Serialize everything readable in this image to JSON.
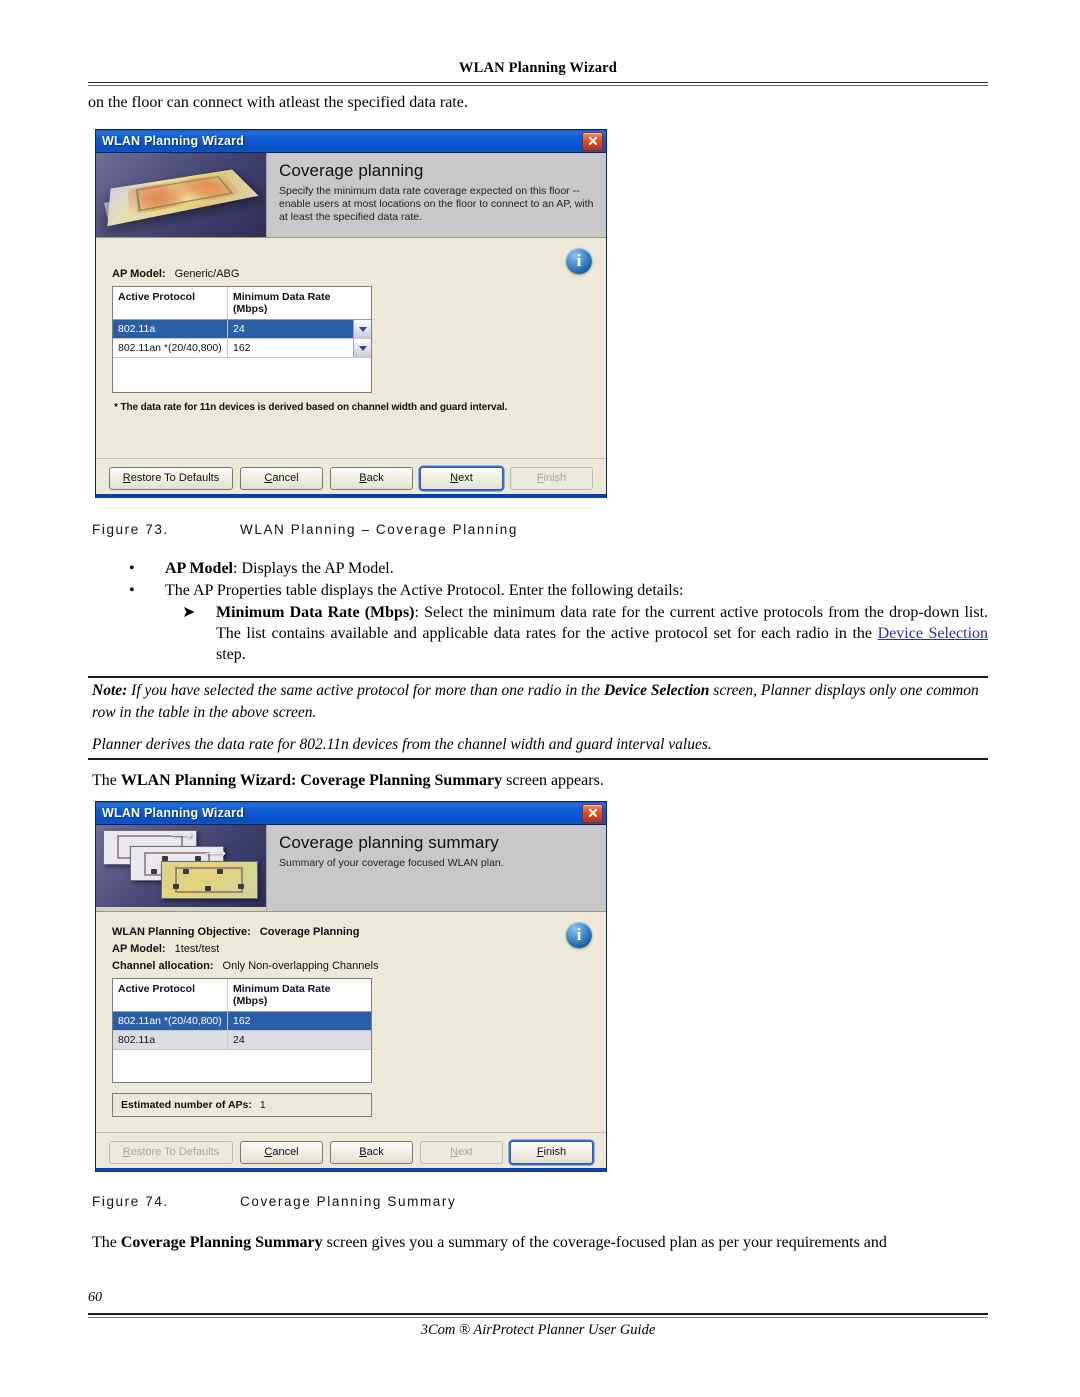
{
  "header": {
    "running_head": "WLAN Planning Wizard"
  },
  "intro_text": "on the floor can connect with atleast the specified data rate.",
  "dialog1": {
    "title": "WLAN Planning Wizard",
    "close_icon": "close-icon",
    "banner": {
      "heading": "Coverage planning",
      "description": "Specify the minimum data rate coverage expected on this floor -- enable users at most locations on the floor to connect to an AP, with at least the specified data rate.",
      "art": "floorplan-heatmap-3d"
    },
    "info_icon": "info-icon",
    "ap_model_label": "AP Model:",
    "ap_model_value": "Generic/ABG",
    "table": {
      "columns": [
        "Active Protocol",
        "Minimum Data Rate (Mbps)"
      ],
      "col1_header": "Active Protocol",
      "col2_header_line1": "Minimum Data Rate",
      "col2_header_line2": "(Mbps)",
      "rows": [
        {
          "protocol": "802.11a",
          "rate": "24",
          "selected": true,
          "dropdown": true
        },
        {
          "protocol": "802.11an *(20/40,800)",
          "rate": "162",
          "selected": false,
          "dropdown": true
        }
      ]
    },
    "footnote": "* The data rate for 11n devices is derived based on channel width and guard interval.",
    "buttons": [
      {
        "label": "Restore To Defaults",
        "accel": "R",
        "state": "enabled",
        "wide": true
      },
      {
        "label": "Cancel",
        "accel": "C",
        "state": "enabled",
        "wide": false
      },
      {
        "label": "Back",
        "accel": "B",
        "state": "enabled",
        "wide": false
      },
      {
        "label": "Next",
        "accel": "N",
        "state": "default",
        "wide": false
      },
      {
        "label": "Finish",
        "accel": "F",
        "state": "disabled",
        "wide": false
      }
    ]
  },
  "figure73": {
    "number": "Figure 73.",
    "caption": "WLAN Planning – Coverage Planning"
  },
  "bullets": {
    "b1_bold": "AP Model",
    "b1_rest": ": Displays the AP Model.",
    "b2": "The AP Properties table displays the Active Protocol. Enter the following details:",
    "sub_bold": "Minimum Data Rate (Mbps)",
    "sub_rest1": ": Select the minimum data rate for the current active protocols from the drop-down",
    "sub_rest2": "list. The list contains available and applicable data rates for the active protocol set for each radio in the ",
    "sub_link": "Device Selection",
    "sub_rest3": " step."
  },
  "note": {
    "label": "Note:",
    "line1_a": " If you have selected the same active protocol for more than one radio in the ",
    "line1_bold": "Device Selection",
    "line1_b": " screen, Planner displays only one",
    "line2": "common row in the table in the above screen.",
    "line3": "Planner derives the data rate for 802.11n devices from the channel width and guard interval values."
  },
  "lead_in": {
    "pre": "The ",
    "bold": "WLAN Planning Wizard: Coverage Planning Summary",
    "post": " screen appears."
  },
  "dialog2": {
    "title": "WLAN Planning Wizard",
    "close_icon": "close-icon",
    "banner": {
      "heading": "Coverage planning summary",
      "description": "Summary of your coverage focused WLAN plan.",
      "art": "stacked-floorplans"
    },
    "info_icon": "info-icon",
    "objective_label": "WLAN Planning Objective:",
    "objective_value": "Coverage Planning",
    "ap_model_label": "AP Model:",
    "ap_model_value": "1test/test",
    "channel_label": "Channel allocation:",
    "channel_value": "Only Non-overlapping Channels",
    "table": {
      "col1_header": "Active Protocol",
      "col2_header_line1": "Minimum Data Rate",
      "col2_header_line2": "(Mbps)",
      "rows": [
        {
          "protocol": "802.11an *(20/40,800)",
          "rate": "162",
          "selected": true,
          "dropdown": false
        },
        {
          "protocol": "802.11a",
          "rate": "24",
          "selected": false,
          "dropdown": false
        }
      ]
    },
    "estimated_label": "Estimated number of APs:",
    "estimated_value": "1",
    "buttons": [
      {
        "label": "Restore To Defaults",
        "accel": "R",
        "state": "disabled",
        "wide": true
      },
      {
        "label": "Cancel",
        "accel": "C",
        "state": "enabled",
        "wide": false
      },
      {
        "label": "Back",
        "accel": "B",
        "state": "enabled",
        "wide": false
      },
      {
        "label": "Next",
        "accel": "N",
        "state": "disabled",
        "wide": false
      },
      {
        "label": "Finish",
        "accel": "F",
        "state": "default",
        "wide": false
      }
    ]
  },
  "figure74": {
    "number": "Figure 74.",
    "caption": "Coverage Planning Summary"
  },
  "closing": {
    "pre": "The ",
    "bold": "Coverage Planning Summary",
    "post": " screen gives you a summary of the coverage-focused plan as per your requirements and"
  },
  "footer": {
    "page_number": "60",
    "text": "3Com ® AirProtect Planner User Guide"
  }
}
